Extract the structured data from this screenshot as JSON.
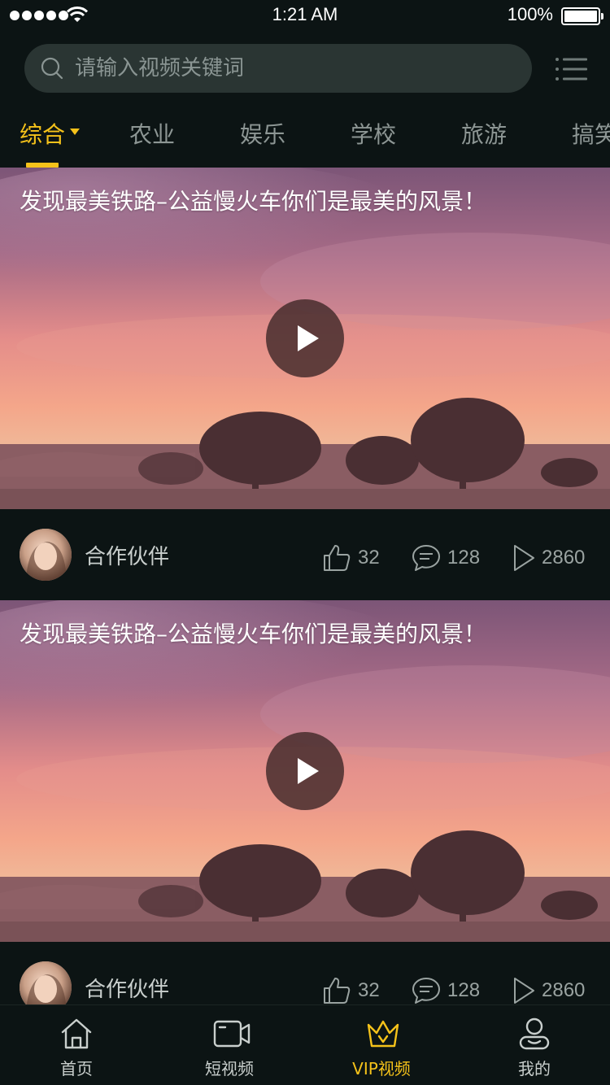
{
  "status_bar": {
    "time": "1:21 AM",
    "battery": "100%"
  },
  "search": {
    "placeholder": "请输入视频关键词"
  },
  "tabs": [
    {
      "label": "综合",
      "active": true
    },
    {
      "label": "农业"
    },
    {
      "label": "娱乐"
    },
    {
      "label": "学校"
    },
    {
      "label": "旅游"
    },
    {
      "label": "搞笑"
    }
  ],
  "videos": [
    {
      "title": "发现最美铁路–公益慢火车你们是最美的风景！",
      "author": "合作伙伴",
      "likes": "32",
      "comments": "128",
      "plays": "2860"
    },
    {
      "title": "发现最美铁路–公益慢火车你们是最美的风景！",
      "author": "合作伙伴",
      "likes": "32",
      "comments": "128",
      "plays": "2860"
    }
  ],
  "nav": [
    {
      "label": "首页",
      "icon": "home-icon"
    },
    {
      "label": "短视频",
      "icon": "video-camera-icon"
    },
    {
      "label": "VIP视频",
      "icon": "crown-icon",
      "active": true
    },
    {
      "label": "我的",
      "icon": "user-icon"
    }
  ],
  "colors": {
    "accent": "#f5c21a",
    "background": "#0c1414",
    "search_bg": "#2a3533"
  }
}
